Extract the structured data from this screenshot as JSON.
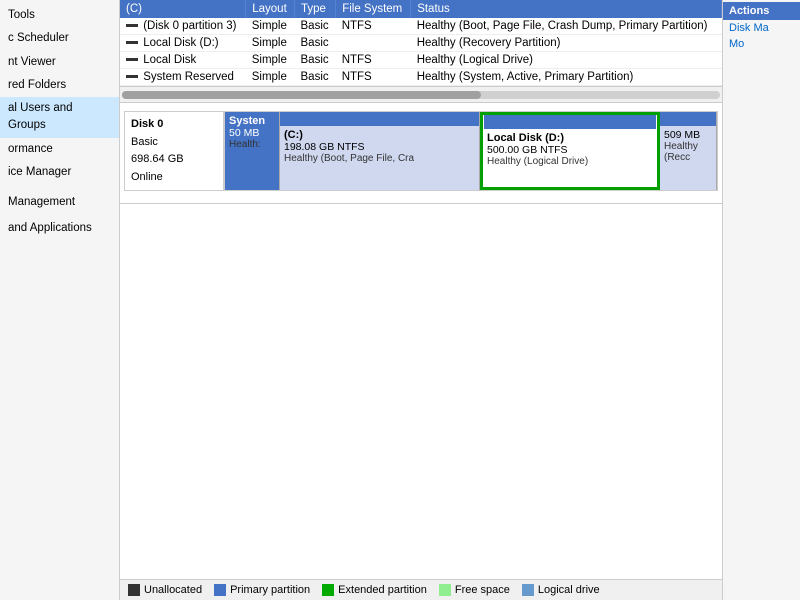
{
  "sidebar": {
    "items": [
      {
        "label": "Tools",
        "selected": false
      },
      {
        "label": "c Scheduler",
        "selected": false
      },
      {
        "label": "nt Viewer",
        "selected": false
      },
      {
        "label": "red Folders",
        "selected": false
      },
      {
        "label": "al Users and Groups",
        "selected": true
      },
      {
        "label": "ormance",
        "selected": false
      },
      {
        "label": "ice Manager",
        "selected": false
      }
    ],
    "sections": [
      {
        "label": "Management"
      },
      {
        "label": "and Applications"
      }
    ]
  },
  "table": {
    "headers": [
      "(C)",
      "Layout",
      "Type",
      "File System",
      "Status"
    ],
    "rows": [
      {
        "name": "(Disk 0 partition 3)",
        "layout": "Simple",
        "type": "Basic",
        "filesystem": "NTFS",
        "status": "Healthy (Boot, Page File, Crash Dump, Primary Partition)"
      },
      {
        "name": "Local Disk (D:)",
        "layout": "Simple",
        "type": "Basic",
        "filesystem": "",
        "status": "Healthy (Recovery Partition)"
      },
      {
        "name": "Local Disk",
        "layout": "Simple",
        "type": "Basic",
        "filesystem": "NTFS",
        "status": "Healthy (Logical Drive)"
      },
      {
        "name": "System Reserved",
        "layout": "Simple",
        "type": "Basic",
        "filesystem": "NTFS",
        "status": "Healthy (System, Active, Primary Partition)"
      }
    ]
  },
  "disk": {
    "name": "Disk 0",
    "type": "Basic",
    "size": "698.64 GB",
    "status": "Online",
    "partitions": [
      {
        "id": "system",
        "label": "Systen",
        "size": "50 MB",
        "status": "Health:"
      },
      {
        "id": "c",
        "label": "(C:)",
        "size": "198.08 GB NTFS",
        "status": "Healthy (Boot, Page File, Cra"
      },
      {
        "id": "d",
        "label": "Local Disk (D:)",
        "size": "500.00 GB NTFS",
        "status": "Healthy (Logical Drive)"
      },
      {
        "id": "recovery",
        "label": "",
        "size": "509 MB",
        "status": "Healthy (Recc"
      }
    ]
  },
  "actions": {
    "header": "Actions",
    "items": [
      {
        "label": "Disk Ma"
      },
      {
        "label": "Mo"
      }
    ]
  },
  "legend": {
    "items": [
      {
        "label": "Unallocated",
        "color": "#333333"
      },
      {
        "label": "Primary partition",
        "color": "#4472c4"
      },
      {
        "label": "Extended partition",
        "color": "#00aa00"
      },
      {
        "label": "Free space",
        "color": "#90ee90"
      },
      {
        "label": "Logical drive",
        "color": "#6699cc"
      }
    ]
  }
}
